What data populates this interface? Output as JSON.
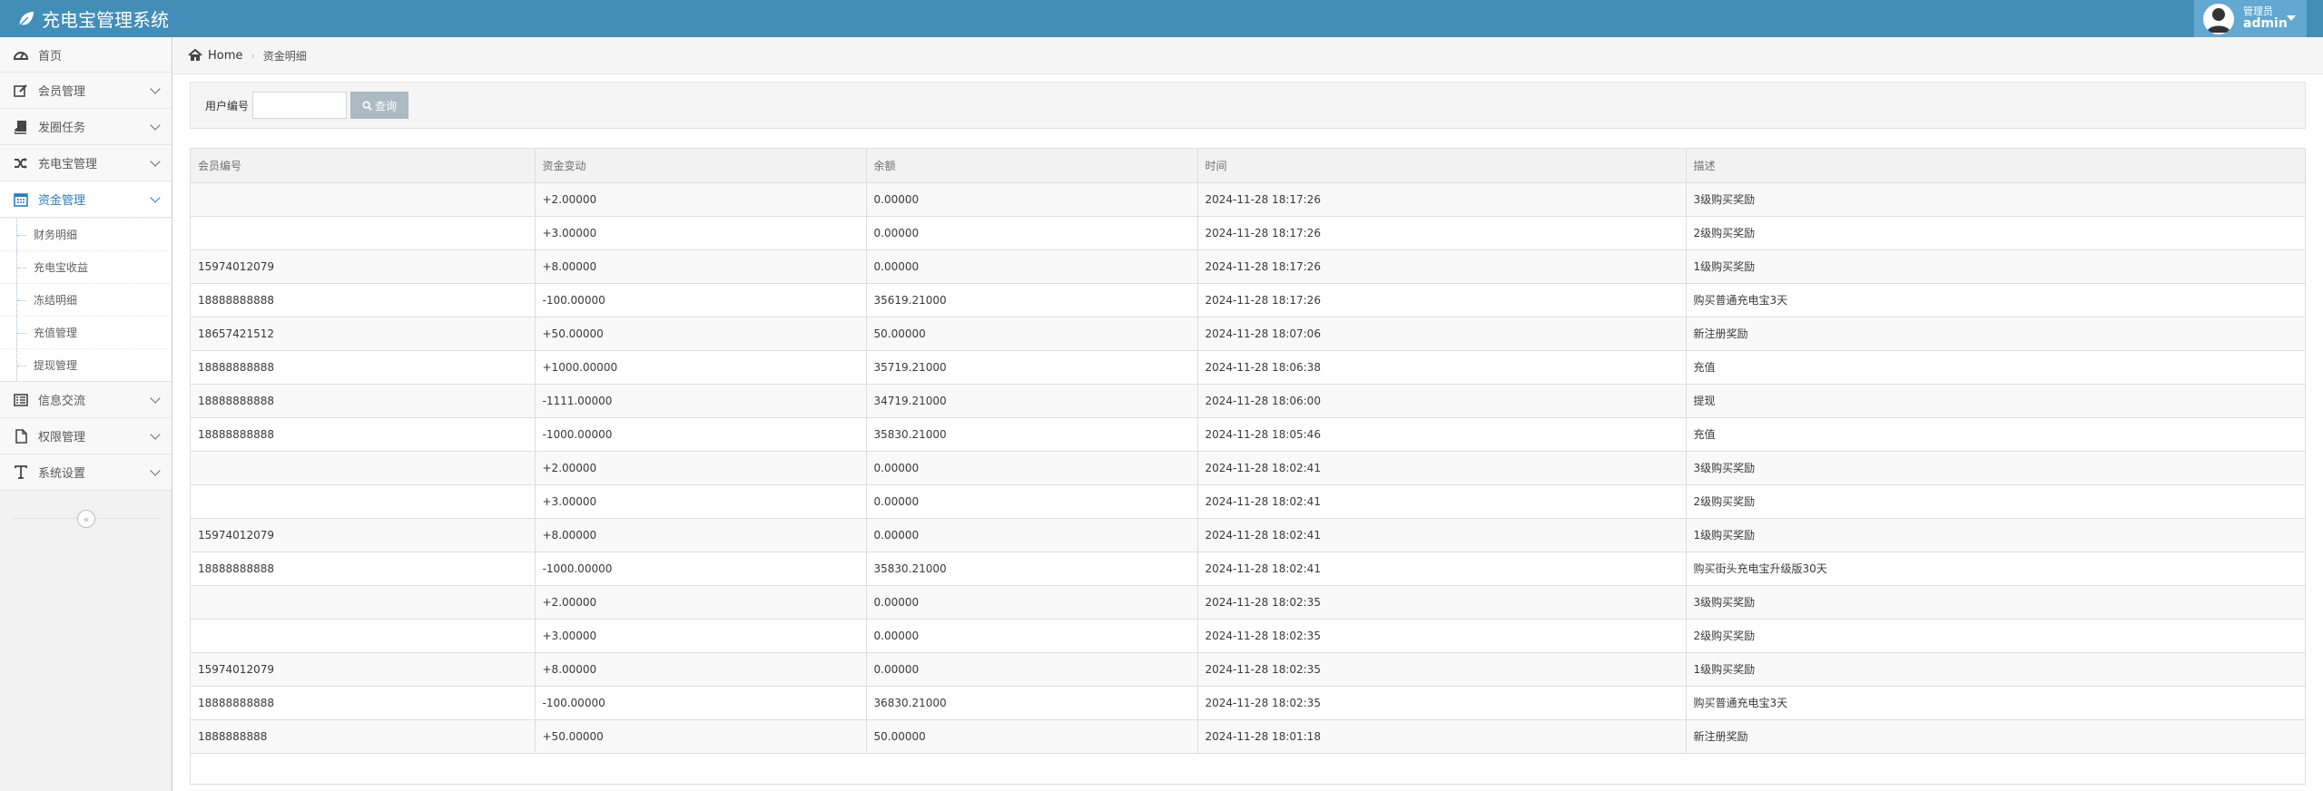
{
  "app": {
    "title": "充电宝管理系统"
  },
  "user": {
    "role": "管理员",
    "name": "admin"
  },
  "sidebar": {
    "items": [
      {
        "label": "首页",
        "icon": "dashboard-icon"
      },
      {
        "label": "会员管理",
        "icon": "edit-icon"
      },
      {
        "label": "发圈任务",
        "icon": "book-icon"
      },
      {
        "label": "充电宝管理",
        "icon": "shuffle-icon"
      },
      {
        "label": "资金管理",
        "icon": "calendar-icon",
        "active": true
      },
      {
        "label": "信息交流",
        "icon": "list-icon"
      },
      {
        "label": "权限管理",
        "icon": "file-icon"
      },
      {
        "label": "系统设置",
        "icon": "text-icon"
      }
    ],
    "submenu": [
      "财务明细",
      "充电宝收益",
      "冻结明细",
      "充值管理",
      "提现管理"
    ]
  },
  "breadcrumb": {
    "home": "Home",
    "current": "资金明细"
  },
  "search": {
    "label": "用户编号",
    "value": "",
    "button": "查询"
  },
  "table": {
    "headers": [
      "会员编号",
      "资金变动",
      "余额",
      "时间",
      "描述"
    ],
    "rows": [
      [
        "",
        "+2.00000",
        "0.00000",
        "2024-11-28 18:17:26",
        "3级购买奖励"
      ],
      [
        "",
        "+3.00000",
        "0.00000",
        "2024-11-28 18:17:26",
        "2级购买奖励"
      ],
      [
        "15974012079",
        "+8.00000",
        "0.00000",
        "2024-11-28 18:17:26",
        "1级购买奖励"
      ],
      [
        "18888888888",
        "-100.00000",
        "35619.21000",
        "2024-11-28 18:17:26",
        "购买普通充电宝3天"
      ],
      [
        "18657421512",
        "+50.00000",
        "50.00000",
        "2024-11-28 18:07:06",
        "新注册奖励"
      ],
      [
        "18888888888",
        "+1000.00000",
        "35719.21000",
        "2024-11-28 18:06:38",
        "充值"
      ],
      [
        "18888888888",
        "-1111.00000",
        "34719.21000",
        "2024-11-28 18:06:00",
        "提现"
      ],
      [
        "18888888888",
        "-1000.00000",
        "35830.21000",
        "2024-11-28 18:05:46",
        "充值"
      ],
      [
        "",
        "+2.00000",
        "0.00000",
        "2024-11-28 18:02:41",
        "3级购买奖励"
      ],
      [
        "",
        "+3.00000",
        "0.00000",
        "2024-11-28 18:02:41",
        "2级购买奖励"
      ],
      [
        "15974012079",
        "+8.00000",
        "0.00000",
        "2024-11-28 18:02:41",
        "1级购买奖励"
      ],
      [
        "18888888888",
        "-1000.00000",
        "35830.21000",
        "2024-11-28 18:02:41",
        "购买街头充电宝升级版30天"
      ],
      [
        "",
        "+2.00000",
        "0.00000",
        "2024-11-28 18:02:35",
        "3级购买奖励"
      ],
      [
        "",
        "+3.00000",
        "0.00000",
        "2024-11-28 18:02:35",
        "2级购买奖励"
      ],
      [
        "15974012079",
        "+8.00000",
        "0.00000",
        "2024-11-28 18:02:35",
        "1级购买奖励"
      ],
      [
        "18888888888",
        "-100.00000",
        "36830.21000",
        "2024-11-28 18:02:35",
        "购买普通充电宝3天"
      ],
      [
        "1888888888",
        "+50.00000",
        "50.00000",
        "2024-11-28 18:01:18",
        "新注册奖励"
      ]
    ]
  },
  "colors": {
    "navbar": "#438eb9",
    "user_box": "#62a8d1",
    "active_menu": "#2b7dbc",
    "search_button": "#abbac3"
  }
}
